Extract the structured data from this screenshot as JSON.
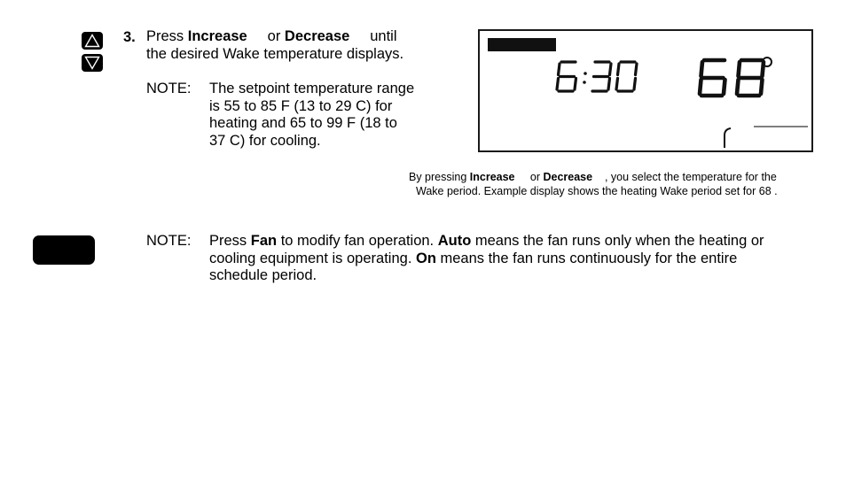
{
  "step": {
    "number": "3.",
    "line1": {
      "prefix": "Press ",
      "increase": "Increase",
      "gap1": "     or ",
      "decrease": "Decrease",
      "suffix": "     until"
    },
    "line2": "the desired Wake temperature displays."
  },
  "note1": {
    "label": "NOTE:",
    "lines": [
      "The setpoint temperature range",
      "is 55 to 85 F (13 to 29 C) for",
      "heating and 65 to 99 F (18 to",
      "37 C) for cooling."
    ]
  },
  "display": {
    "time": "6:30",
    "temperature": "68",
    "degree_symbol": "°"
  },
  "caption": {
    "line1": {
      "prefix": "By pressing ",
      "increase": "Increase",
      "gap1": "     or ",
      "decrease": "Decrease",
      "suffix": "    , you select the temperature for the"
    },
    "line2": "Wake period. Example display shows the heating Wake period set for 68 ."
  },
  "note2": {
    "label": "NOTE:",
    "line1": {
      "p1": "Press ",
      "fan": "Fan",
      "p2": " to modify fan operation. ",
      "auto": "Auto",
      "p3": " means the fan runs only when the heating or"
    },
    "line2": {
      "p1": "cooling equipment is operating. ",
      "on": "On",
      "p2": " means the fan runs continuously for the entire"
    },
    "line3": "schedule period."
  },
  "icons": {
    "increase": "triangle-up-icon",
    "decrease": "triangle-down-icon",
    "fan": "fan-button"
  }
}
